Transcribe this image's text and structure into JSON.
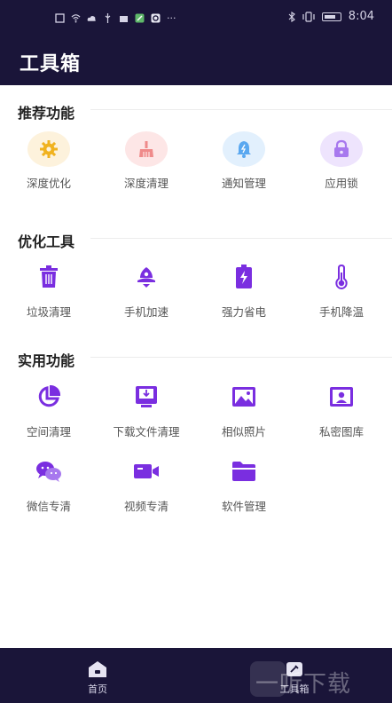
{
  "status_bar": {
    "time": "8:04"
  },
  "header": {
    "title": "工具箱"
  },
  "sections": {
    "recommended": {
      "title": "推荐功能",
      "items": [
        {
          "label": "深度优化",
          "icon": "gear-icon",
          "color": "#f0b21f",
          "bg": "#fdf2dc"
        },
        {
          "label": "深度清理",
          "icon": "broom-icon",
          "color": "#ef8a8a",
          "bg": "#fde6e6"
        },
        {
          "label": "通知管理",
          "icon": "bell-icon",
          "color": "#5aa8f0",
          "bg": "#e2f0fd"
        },
        {
          "label": "应用锁",
          "icon": "lock-icon",
          "color": "#a778ee",
          "bg": "#eee4fd"
        }
      ]
    },
    "optimize": {
      "title": "优化工具",
      "items": [
        {
          "label": "垃圾清理",
          "icon": "trash-icon"
        },
        {
          "label": "手机加速",
          "icon": "rocket-icon"
        },
        {
          "label": "强力省电",
          "icon": "battery-bolt-icon"
        },
        {
          "label": "手机降温",
          "icon": "thermometer-icon"
        }
      ]
    },
    "utility": {
      "title": "实用功能",
      "items": [
        {
          "label": "空间清理",
          "icon": "pie-chart-icon"
        },
        {
          "label": "下载文件清理",
          "icon": "download-icon"
        },
        {
          "label": "相似照片",
          "icon": "photo-icon"
        },
        {
          "label": "私密图库",
          "icon": "private-gallery-icon"
        },
        {
          "label": "微信专清",
          "icon": "wechat-icon"
        },
        {
          "label": "视频专清",
          "icon": "video-icon"
        },
        {
          "label": "软件管理",
          "icon": "folder-icon"
        }
      ]
    }
  },
  "bottom_nav": {
    "home_label": "首页",
    "tools_label": "工具箱"
  },
  "watermark": {
    "text": "一听下载"
  },
  "colors": {
    "accent": "#7a2ee0",
    "nav_bg": "#1a1539"
  }
}
